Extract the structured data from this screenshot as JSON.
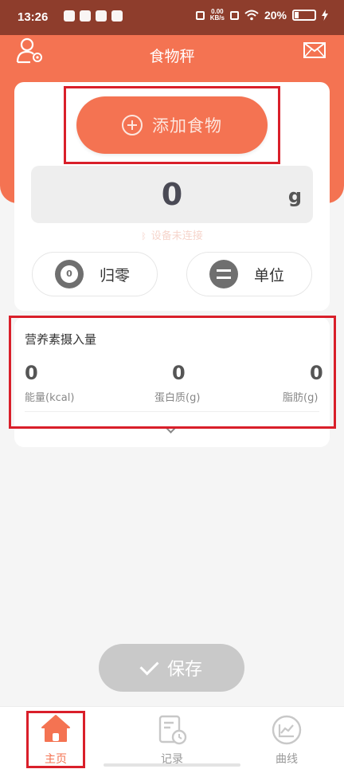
{
  "status_bar": {
    "time": "13:26",
    "net_speed_value": "0.00",
    "net_speed_unit": "KB/s",
    "battery": "20%"
  },
  "header": {
    "title": "食物秤"
  },
  "scale": {
    "add_food_label": "添加食物",
    "weight_value": "0",
    "weight_unit": "g",
    "device_status": "设备未连接",
    "zero_label": "归零",
    "unit_label": "单位"
  },
  "nutrition": {
    "title": "营养素摄入量",
    "items": [
      {
        "value": "0",
        "label": "能量(kcal)"
      },
      {
        "value": "0",
        "label": "蛋白质(g)"
      },
      {
        "value": "0",
        "label": "脂肪(g)"
      }
    ]
  },
  "actions": {
    "save_label": "保存"
  },
  "bottom_nav": {
    "items": [
      {
        "label": "主页",
        "icon": "home-icon",
        "active": true
      },
      {
        "label": "记录",
        "icon": "record-icon",
        "active": false
      },
      {
        "label": "曲线",
        "icon": "curve-icon",
        "active": false
      }
    ]
  },
  "colors": {
    "accent": "#f47352",
    "status_bar": "#8e3d2c",
    "highlight": "#d91f2a",
    "disabled": "#c9c9c9"
  }
}
